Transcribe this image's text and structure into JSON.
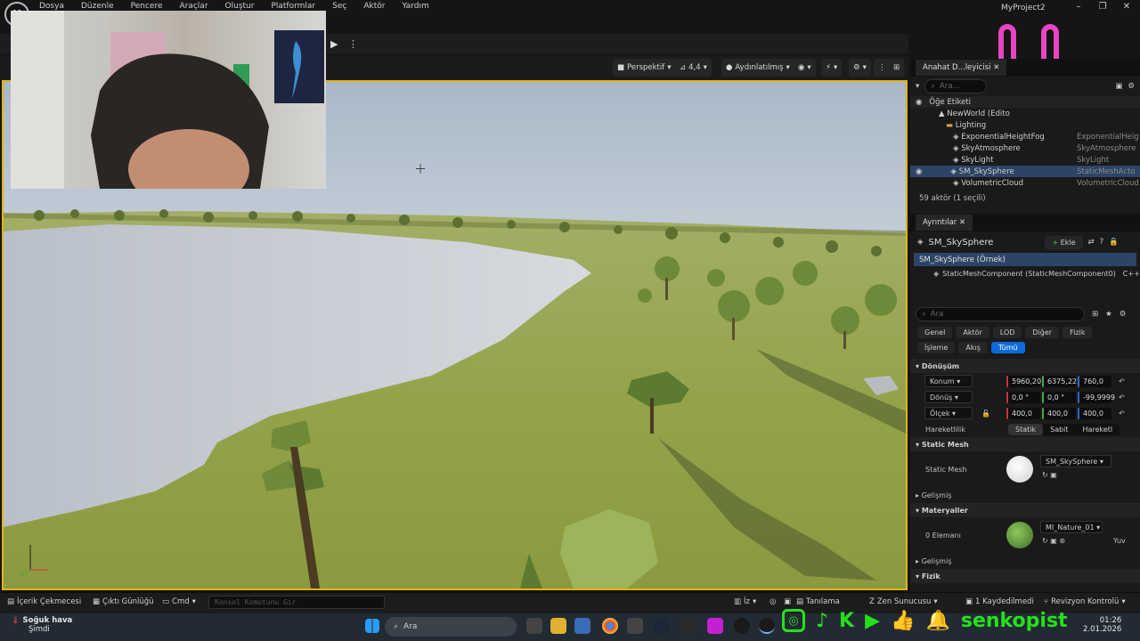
{
  "menu": [
    "Dosya",
    "Düzenle",
    "Pencere",
    "Araçlar",
    "Oluştur",
    "Platformlar",
    "Seç",
    "Aktör",
    "Yardım"
  ],
  "project_name": "MyProject2",
  "viewport": {
    "perspective": "Perspektif",
    "speed": "4,4",
    "lighting": "Aydınlatılmış"
  },
  "outliner": {
    "tab": "Anahat D...leyicisi",
    "search_placeholder": "Ara...",
    "header": "Öğe Etiketi",
    "rows": [
      {
        "label": "NewWorld (Edito",
        "type": ""
      },
      {
        "label": "Lighting",
        "type": ""
      },
      {
        "label": "ExponentialHeightFog",
        "type": "ExponentialHeig"
      },
      {
        "label": "SkyAtmosphere",
        "type": "SkyAtmosphere"
      },
      {
        "label": "SkyLight",
        "type": "SkyLight"
      },
      {
        "label": "SM_SkySphere",
        "type": "StaticMeshActo"
      },
      {
        "label": "VolumetricCloud",
        "type": "VolumetricCloud"
      }
    ],
    "footer": "59 aktör (1 seçili)"
  },
  "details": {
    "tab": "Ayrıntılar",
    "actor_name": "SM_SkySphere",
    "add_label": "Ekle",
    "instance": "SM_SkySphere (Örnek)",
    "component": "StaticMeshComponent (StaticMeshComponent0)",
    "component_suffix": "C++",
    "search_placeholder": "Ara",
    "filters_row1": [
      "Genel",
      "Aktör",
      "LOD",
      "Diğer",
      "Fizik"
    ],
    "filters_row2": [
      "İşleme",
      "Akış",
      "Tümü"
    ],
    "sec_transform": "Dönüşüm",
    "location_label": "Konum",
    "location": [
      "5960,207",
      "6375,222",
      "760,0"
    ],
    "rotation_label": "Dönüş",
    "rotation": [
      "0,0 °",
      "0,0 °",
      "-99,9999"
    ],
    "scale_label": "Ölçek",
    "scale": [
      "400,0",
      "400,0",
      "400,0"
    ],
    "mobility_label": "Hareketlilik",
    "mobility": [
      "Statik",
      "Sabit",
      "Hareketl"
    ],
    "sec_mesh": "Static Mesh",
    "mesh_label": "Static Mesh",
    "mesh_value": "SM_SkySphere",
    "advanced": "Gelişmiş",
    "sec_materials": "Materyaller",
    "elements": "0 Elemanı",
    "material_value": "MI_Nature_01",
    "material_suffix": "Yuv",
    "advanced2": "Gelişmiş",
    "sec_physics": "Fizik"
  },
  "statusbar": {
    "content_drawer": "İçerik Çekmecesi",
    "output_log": "Çıktı Günlüğü",
    "cmd": "Cmd",
    "console_placeholder": "Konsol Komutunu Gir",
    "trace": "İz",
    "derived": "Tanılama",
    "zen": "Zen Sunucusu",
    "unsaved": "1 Kaydedilmedi",
    "revision": "Revizyon Kontrolü"
  },
  "taskbar": {
    "weather_title": "Soğuk hava",
    "weather_sub": "Şimdi",
    "search": "Ara",
    "time": "01:26",
    "date": "2.01.2026"
  },
  "brand": "senkopist",
  "colors": {
    "selection": "#e3b316",
    "accent": "#0d6ad9",
    "brand": "#25e11b",
    "overlay": "#e845c4"
  }
}
